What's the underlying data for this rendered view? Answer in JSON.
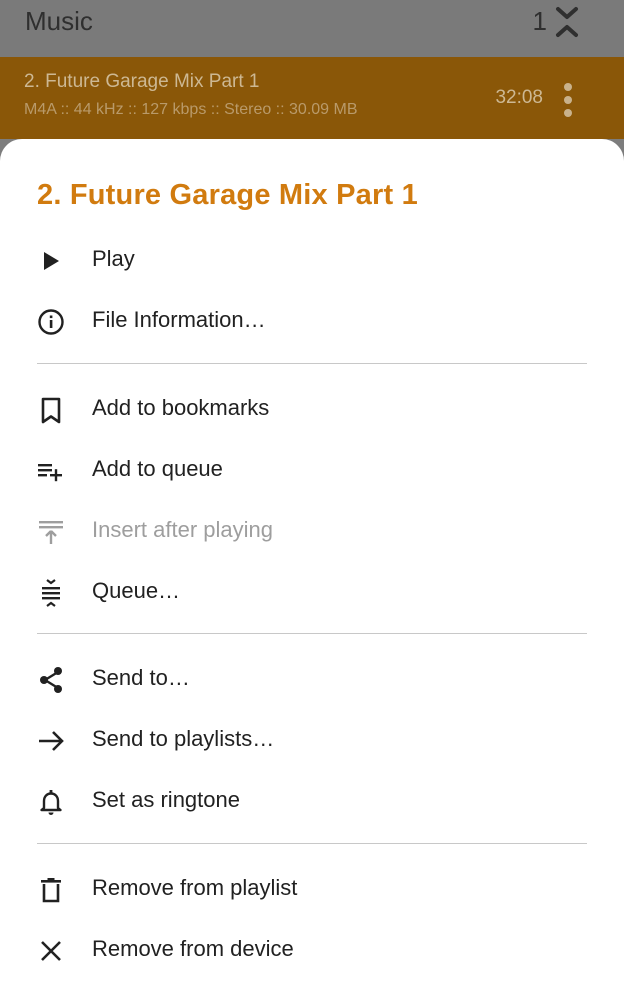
{
  "app_bar": {
    "title": "Music",
    "count": "1"
  },
  "track": {
    "title": "2. Future Garage Mix Part 1",
    "meta": "M4A :: 44 kHz :: 127 kbps :: Stereo :: 30.09 MB",
    "duration": "32:08"
  },
  "sheet": {
    "title": "2. Future Garage Mix Part 1",
    "items": [
      {
        "label": "Play",
        "icon": "play-icon",
        "enabled": true
      },
      {
        "label": "File Information…",
        "icon": "info-icon",
        "enabled": true
      },
      {
        "label": "Add to bookmarks",
        "icon": "bookmark-icon",
        "enabled": true
      },
      {
        "label": "Add to queue",
        "icon": "playlist-add-icon",
        "enabled": true
      },
      {
        "label": "Insert after playing",
        "icon": "insert-after-icon",
        "enabled": false
      },
      {
        "label": "Queue…",
        "icon": "queue-icon",
        "enabled": true
      },
      {
        "label": "Send to…",
        "icon": "share-icon",
        "enabled": true
      },
      {
        "label": "Send to playlists…",
        "icon": "arrow-right-icon",
        "enabled": true
      },
      {
        "label": "Set as ringtone",
        "icon": "bell-icon",
        "enabled": true
      },
      {
        "label": "Remove from playlist",
        "icon": "trash-icon",
        "enabled": true
      },
      {
        "label": "Remove from device",
        "icon": "close-icon",
        "enabled": true
      }
    ]
  },
  "colors": {
    "accent": "#d17b0f",
    "track_row": "#8a5708",
    "text": "#212121",
    "disabled_text": "#9e9e9e"
  }
}
